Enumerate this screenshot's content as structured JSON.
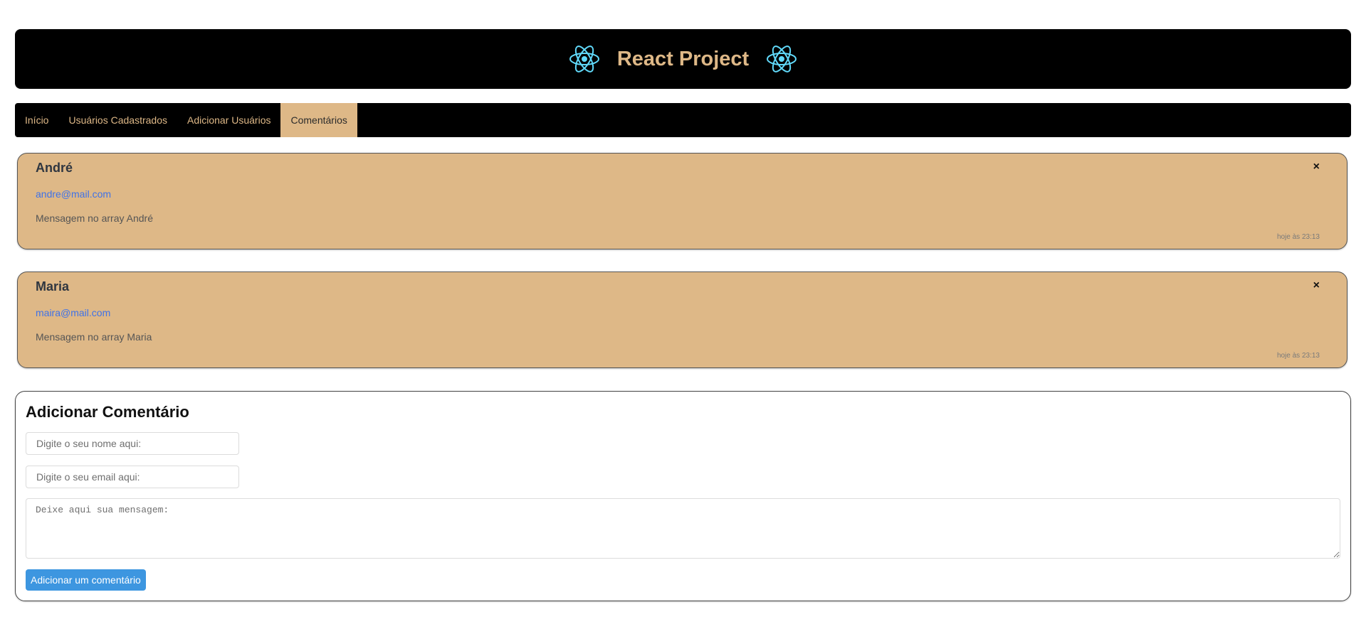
{
  "header": {
    "title": "React Project",
    "logo_icon": "react-atom-icon",
    "logo_color": "#61dafb"
  },
  "nav": {
    "items": [
      {
        "label": "Início",
        "active": false
      },
      {
        "label": "Usuários Cadastrados",
        "active": false
      },
      {
        "label": "Adicionar Usuários",
        "active": false
      },
      {
        "label": "Comentários",
        "active": true
      }
    ]
  },
  "comments": [
    {
      "name": "André",
      "email": "andre@mail.com",
      "message": "Mensagem no array André",
      "time": "hoje às 23:13",
      "close_label": "×"
    },
    {
      "name": "Maria",
      "email": "maira@mail.com",
      "message": "Mensagem no array Maria",
      "time": "hoje às 23:13",
      "close_label": "×"
    }
  ],
  "form": {
    "title": "Adicionar Comentário",
    "name_placeholder": "Digite o seu nome aqui:",
    "email_placeholder": "Digite o seu email aqui:",
    "message_placeholder": "Deixe aqui sua mensagem:",
    "submit_label": "Adicionar um comentário"
  },
  "colors": {
    "accent": "#deb887",
    "header_bg": "#000000",
    "link": "#3f72e8",
    "button": "#3d96e0"
  }
}
